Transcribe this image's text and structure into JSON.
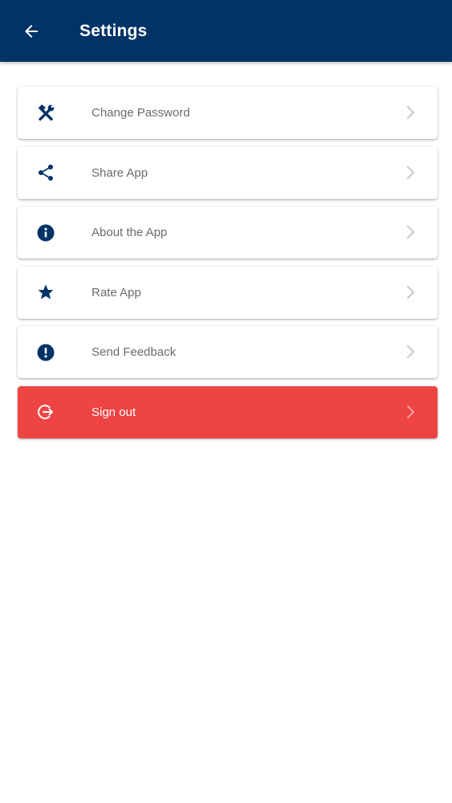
{
  "app_bar": {
    "title": "Settings",
    "background": "#023366",
    "back_icon": "arrow-left-icon"
  },
  "menu": {
    "items": [
      {
        "label": "Change Password",
        "icon": "tools-icon",
        "danger": false
      },
      {
        "label": "Share App",
        "icon": "share-icon",
        "danger": false
      },
      {
        "label": "About the App",
        "icon": "info-icon",
        "danger": false
      },
      {
        "label": "Rate App",
        "icon": "star-icon",
        "danger": false
      },
      {
        "label": "Send Feedback",
        "icon": "alert-icon",
        "danger": false
      },
      {
        "label": "Sign out",
        "icon": "sign-out-icon",
        "danger": true
      }
    ]
  },
  "colors": {
    "primary": "#023366",
    "danger": "#ee4444",
    "label": "#6b6b6b",
    "chevron": "#c8c8c8"
  }
}
